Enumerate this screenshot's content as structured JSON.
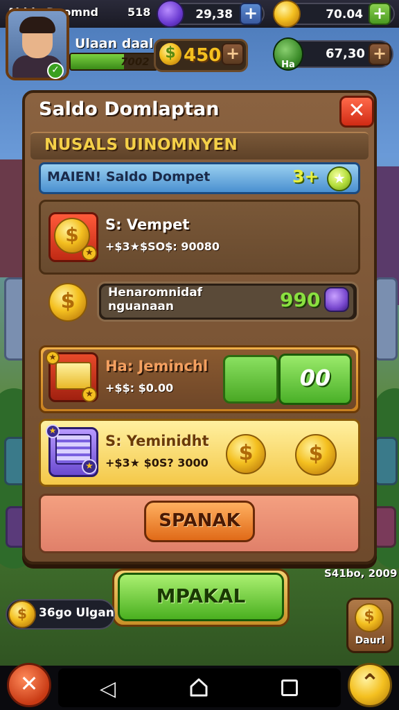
{
  "top_bar": {
    "title": "Ahbie Doomnd",
    "count": "518",
    "gem_value": "29,38",
    "coin_value": "70.04",
    "gem_plus": "+",
    "coin_plus": "+"
  },
  "player": {
    "name": "Ulaan daal",
    "xp_text": "7002",
    "xp_progress": 0.62,
    "coin_amount": "450",
    "coin_plus": "+",
    "secondary_value": "67,30",
    "secondary_icon_label": "Ha",
    "secondary_plus": "+",
    "verified_glyph": "✓"
  },
  "dialog": {
    "title": "Saldo Domlaptan",
    "close_glyph": "✕",
    "section_title": "NUSALS UINOMNYEN",
    "info_bar": {
      "label": "MAIEN! Saldo Dompet",
      "value": "3+",
      "icon_glyph": "★"
    },
    "item_1": {
      "name": "S: Vempet",
      "sub": "+$3★$SO$: 90080",
      "coin_glyph": "$",
      "star_glyph": "★"
    },
    "wallet": {
      "label": "Henaromnidaf nguanaan",
      "value": "990",
      "coin_glyph": "$"
    },
    "item_2": {
      "name": "Ha: Jeminchl",
      "sub": "+$$: $0.00",
      "button_label": "00",
      "star_glyph": "★"
    },
    "item_3": {
      "name": "S: Yeminidht",
      "sub": "+$3★ $0S? 3000",
      "coin_glyph": "$",
      "star_glyph": "★"
    },
    "action_button": "SPANAK"
  },
  "footer": {
    "main_button": "MPAKAL",
    "left_pill_text": "36go Ulgan",
    "left_coin_glyph": "$",
    "side_text": "S41bo, 2009",
    "dollar_card_label": "Daurl",
    "dollar_card_glyph": "$",
    "left_circle_glyph": "✕",
    "right_circle_glyph": "⌃"
  },
  "nav": {
    "back_glyph": "◁"
  },
  "colors": {
    "accent_green": "#4ab020",
    "coin_gold": "#f4c020",
    "close_red": "#d02a14",
    "panel_brown": "#6e4a2c"
  },
  "icons": [
    "gem-icon",
    "coin-icon",
    "plus-icon",
    "close-icon",
    "star-icon",
    "dollar-icon",
    "tree-icon",
    "back-icon",
    "home-icon",
    "recent-apps-icon"
  ]
}
